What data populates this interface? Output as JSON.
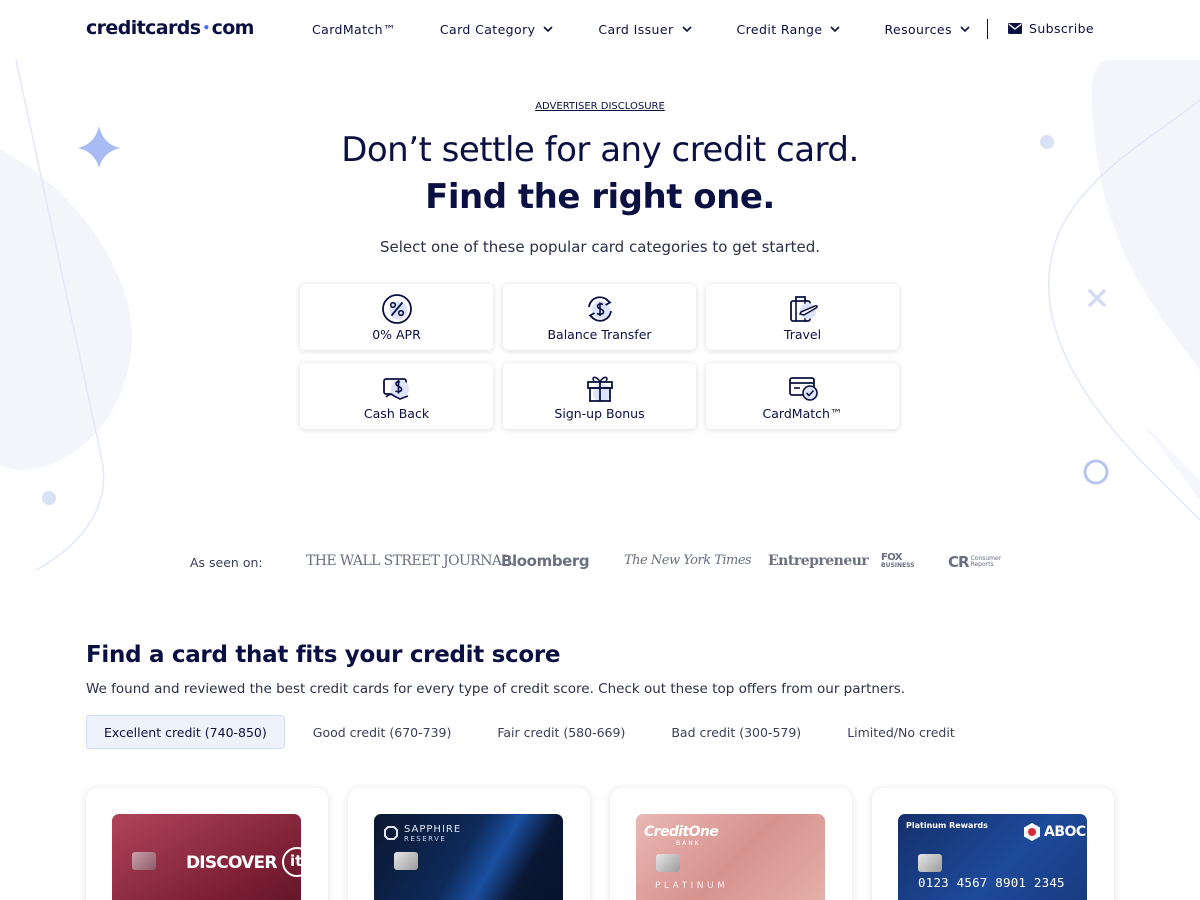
{
  "header": {
    "logo": {
      "left": "creditcards",
      "dot": "•",
      "right": "com"
    },
    "nav": [
      {
        "label": "CardMatch™",
        "dropdown": false
      },
      {
        "label": "Card Category",
        "dropdown": true
      },
      {
        "label": "Card Issuer",
        "dropdown": true
      },
      {
        "label": "Credit Range",
        "dropdown": true
      },
      {
        "label": "Resources",
        "dropdown": true
      }
    ],
    "subscribe": "Subscribe"
  },
  "hero": {
    "disclosure": "ADVERTISER DISCLOSURE",
    "title_line1": "Don’t settle for any credit card.",
    "title_line2": "Find the right one.",
    "subtitle": "Select one of these popular card categories to get started.",
    "categories": [
      {
        "label": "0% APR",
        "icon": "percent-icon"
      },
      {
        "label": "Balance Transfer",
        "icon": "balance-transfer-icon"
      },
      {
        "label": "Travel",
        "icon": "luggage-plane-icon"
      },
      {
        "label": "Cash Back",
        "icon": "cash-back-icon"
      },
      {
        "label": "Sign-up Bonus",
        "icon": "gift-icon"
      },
      {
        "label": "CardMatch™",
        "icon": "card-check-icon"
      }
    ]
  },
  "seen_on": {
    "label": "As seen on:",
    "outlets": {
      "wsj": "THE WALL STREET JOURNAL.",
      "bloomberg": "Bloomberg",
      "nyt": "The New York Times",
      "entrepreneur": "Entrepreneur",
      "fox": "FOX",
      "fox_sub": "BUSINESS",
      "cr": "CR",
      "cr_sub1": "Consumer",
      "cr_sub2": "Reports"
    }
  },
  "credit_section": {
    "title": "Find a card that fits your credit score",
    "subtitle": "We found and reviewed the best credit cards for every type of credit score. Check out these top offers from our partners.",
    "tabs": [
      {
        "label": "Excellent credit (740-850)",
        "active": true
      },
      {
        "label": "Good credit (670-739)",
        "active": false
      },
      {
        "label": "Fair credit (580-669)",
        "active": false
      },
      {
        "label": "Bad credit (300-579)",
        "active": false
      },
      {
        "label": "Limited/No credit",
        "active": false
      }
    ],
    "cards": [
      {
        "brand": "DISCOVER",
        "extra": "it"
      },
      {
        "brand": "SAPPHIRE",
        "sub": "RESERVE"
      },
      {
        "brand": "CreditOne",
        "sub": "BANK",
        "tier": "PLATINUM"
      },
      {
        "brand": "ABOC",
        "tier": "Platinum Rewards",
        "number": "0123 4567 8901 2345"
      }
    ]
  },
  "colors": {
    "navy": "#0b1042",
    "accent": "#4b6bff",
    "tab_active_bg": "#eef2fb"
  }
}
